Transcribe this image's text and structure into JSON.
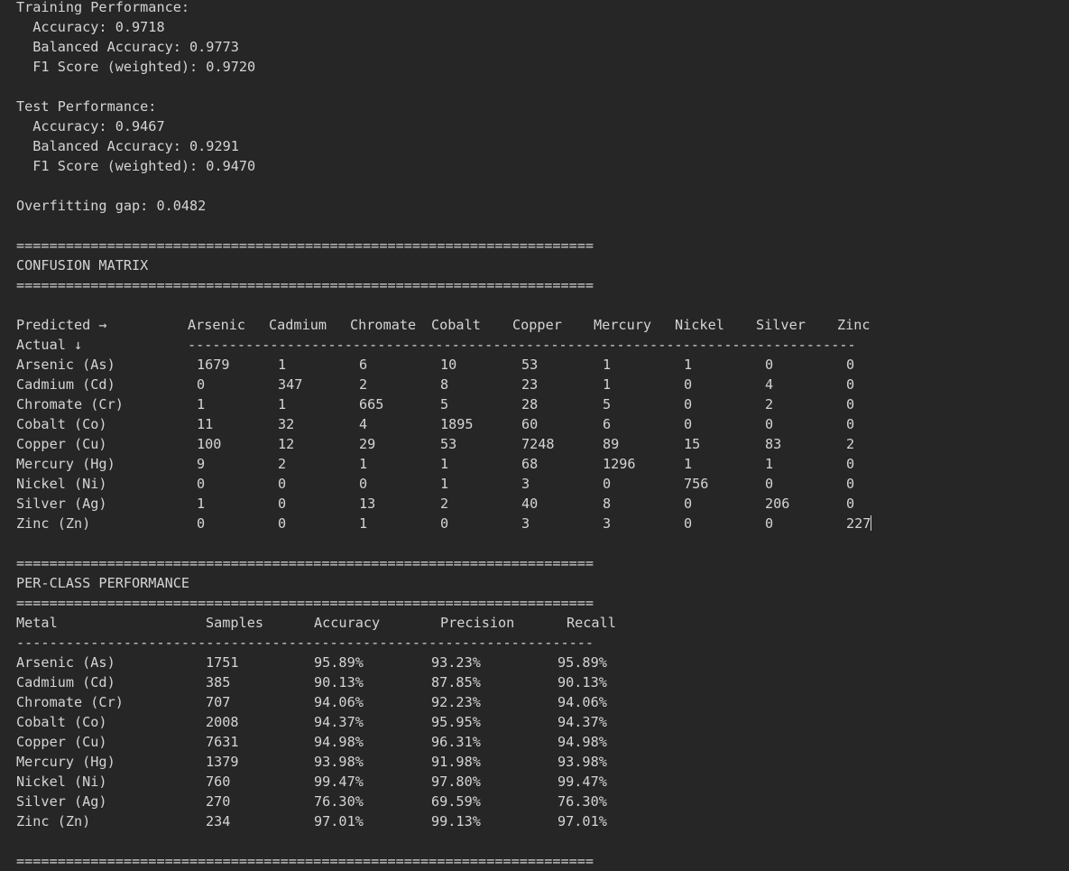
{
  "training": {
    "heading": "Training Performance:",
    "accuracy": "  Accuracy: 0.9718",
    "balanced_accuracy": "  Balanced Accuracy: 0.9773",
    "f1": "  F1 Score (weighted): 0.9720"
  },
  "test": {
    "heading": "Test Performance:",
    "accuracy": "  Accuracy: 0.9467",
    "balanced_accuracy": "  Balanced Accuracy: 0.9291",
    "f1": "  F1 Score (weighted): 0.9470"
  },
  "overfitting_gap": "Overfitting gap: 0.0482",
  "separators": {
    "equals": "======================================================================",
    "dashes_cm": "---------------------------------------------------------------------------------",
    "dashes_pc": "----------------------------------------------------------------------"
  },
  "confusion_matrix": {
    "title": "CONFUSION MATRIX",
    "predicted_label": "Predicted →",
    "actual_label": "Actual ↓",
    "columns": [
      "Arsenic",
      "Cadmium",
      "Chromate",
      "Cobalt",
      "Copper",
      "Mercury",
      "Nickel",
      "Silver",
      "Zinc"
    ],
    "rows": [
      {
        "label": "Arsenic (As)",
        "values": [
          "1679",
          "1",
          "6",
          "10",
          "53",
          "1",
          "1",
          "0",
          "0"
        ]
      },
      {
        "label": "Cadmium (Cd)",
        "values": [
          "0",
          "347",
          "2",
          "8",
          "23",
          "1",
          "0",
          "4",
          "0"
        ]
      },
      {
        "label": "Chromate (Cr)",
        "values": [
          "1",
          "1",
          "665",
          "5",
          "28",
          "5",
          "0",
          "2",
          "0"
        ]
      },
      {
        "label": "Cobalt (Co)",
        "values": [
          "11",
          "32",
          "4",
          "1895",
          "60",
          "6",
          "0",
          "0",
          "0"
        ]
      },
      {
        "label": "Copper (Cu)",
        "values": [
          "100",
          "12",
          "29",
          "53",
          "7248",
          "89",
          "15",
          "83",
          "2"
        ]
      },
      {
        "label": "Mercury (Hg)",
        "values": [
          "9",
          "2",
          "1",
          "1",
          "68",
          "1296",
          "1",
          "1",
          "0"
        ]
      },
      {
        "label": "Nickel (Ni)",
        "values": [
          "0",
          "0",
          "0",
          "1",
          "3",
          "0",
          "756",
          "0",
          "0"
        ]
      },
      {
        "label": "Silver (Ag)",
        "values": [
          "1",
          "0",
          "13",
          "2",
          "40",
          "8",
          "0",
          "206",
          "0"
        ]
      },
      {
        "label": "Zinc (Zn)",
        "values": [
          "0",
          "0",
          "1",
          "0",
          "3",
          "3",
          "0",
          "0",
          "227"
        ]
      }
    ]
  },
  "per_class": {
    "title": "PER-CLASS PERFORMANCE",
    "headers": [
      "Metal",
      "Samples",
      "Accuracy",
      "Precision",
      "Recall"
    ],
    "rows": [
      [
        "Arsenic (As)",
        "1751",
        "95.89%",
        "93.23%",
        "95.89%"
      ],
      [
        "Cadmium (Cd)",
        "385",
        "90.13%",
        "87.85%",
        "90.13%"
      ],
      [
        "Chromate (Cr)",
        "707",
        "94.06%",
        "92.23%",
        "94.06%"
      ],
      [
        "Cobalt (Co)",
        "2008",
        "94.37%",
        "95.95%",
        "94.37%"
      ],
      [
        "Copper (Cu)",
        "7631",
        "94.98%",
        "96.31%",
        "94.98%"
      ],
      [
        "Mercury (Hg)",
        "1379",
        "93.98%",
        "91.98%",
        "93.98%"
      ],
      [
        "Nickel (Ni)",
        "760",
        "99.47%",
        "97.80%",
        "99.47%"
      ],
      [
        "Silver (Ag)",
        "270",
        "76.30%",
        "69.59%",
        "76.30%"
      ],
      [
        "Zinc (Zn)",
        "234",
        "97.01%",
        "99.13%",
        "97.01%"
      ]
    ]
  }
}
